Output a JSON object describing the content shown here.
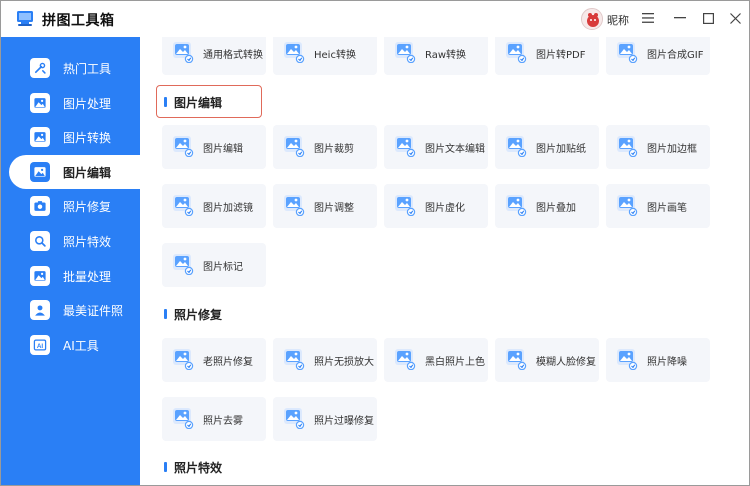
{
  "app": {
    "title": "拼图工具箱",
    "username": "昵称",
    "accent_color": "#2a7ff5"
  },
  "window_controls": {
    "menu_icon": "menu-icon",
    "minimize_icon": "minimize-icon",
    "maximize_icon": "maximize-icon",
    "close_icon": "close-icon"
  },
  "sidebar": {
    "items": [
      {
        "label": "热门工具",
        "icon": "fire-tools-icon"
      },
      {
        "label": "图片处理",
        "icon": "image-process-icon"
      },
      {
        "label": "图片转换",
        "icon": "image-convert-icon"
      },
      {
        "label": "图片编辑",
        "icon": "image-edit-icon",
        "active": true
      },
      {
        "label": "照片修复",
        "icon": "photo-repair-icon"
      },
      {
        "label": "照片特效",
        "icon": "photo-effects-icon"
      },
      {
        "label": "批量处理",
        "icon": "batch-process-icon"
      },
      {
        "label": "最美证件照",
        "icon": "id-photo-icon"
      },
      {
        "label": "AI工具",
        "icon": "ai-tools-icon"
      }
    ]
  },
  "content": {
    "top_row": [
      {
        "label": "通用格式转换",
        "icon": "format-convert-icon"
      },
      {
        "label": "Heic转换",
        "icon": "heic-convert-icon"
      },
      {
        "label": "Raw转换",
        "icon": "raw-convert-icon"
      },
      {
        "label": "图片转PDF",
        "icon": "image-to-pdf-icon"
      },
      {
        "label": "图片合成GIF",
        "icon": "gif-compose-icon"
      }
    ],
    "sections": [
      {
        "title": "图片编辑",
        "tools": [
          {
            "label": "图片编辑",
            "icon": "image-edit-tool-icon"
          },
          {
            "label": "图片裁剪",
            "icon": "image-crop-icon"
          },
          {
            "label": "图片文本编辑",
            "icon": "image-text-edit-icon"
          },
          {
            "label": "图片加贴纸",
            "icon": "image-sticker-icon"
          },
          {
            "label": "图片加边框",
            "icon": "image-border-icon"
          },
          {
            "label": "图片加滤镜",
            "icon": "image-filter-icon"
          },
          {
            "label": "图片调整",
            "icon": "image-adjust-icon"
          },
          {
            "label": "图片虚化",
            "icon": "image-blur-icon"
          },
          {
            "label": "图片叠加",
            "icon": "image-overlay-icon"
          },
          {
            "label": "图片画笔",
            "icon": "image-brush-icon"
          },
          {
            "label": "图片标记",
            "icon": "image-mark-icon"
          }
        ]
      },
      {
        "title": "照片修复",
        "tools": [
          {
            "label": "老照片修复",
            "icon": "old-photo-repair-icon"
          },
          {
            "label": "照片无损放大",
            "icon": "photo-upscale-icon"
          },
          {
            "label": "黑白照片上色",
            "icon": "photo-colorize-icon"
          },
          {
            "label": "模糊人脸修复",
            "icon": "face-restore-icon"
          },
          {
            "label": "照片降噪",
            "icon": "photo-denoise-icon"
          },
          {
            "label": "照片去雾",
            "icon": "photo-dehaze-icon"
          },
          {
            "label": "照片过曝修复",
            "icon": "overexposure-fix-icon"
          }
        ]
      },
      {
        "title": "照片特效",
        "tools": []
      }
    ]
  }
}
